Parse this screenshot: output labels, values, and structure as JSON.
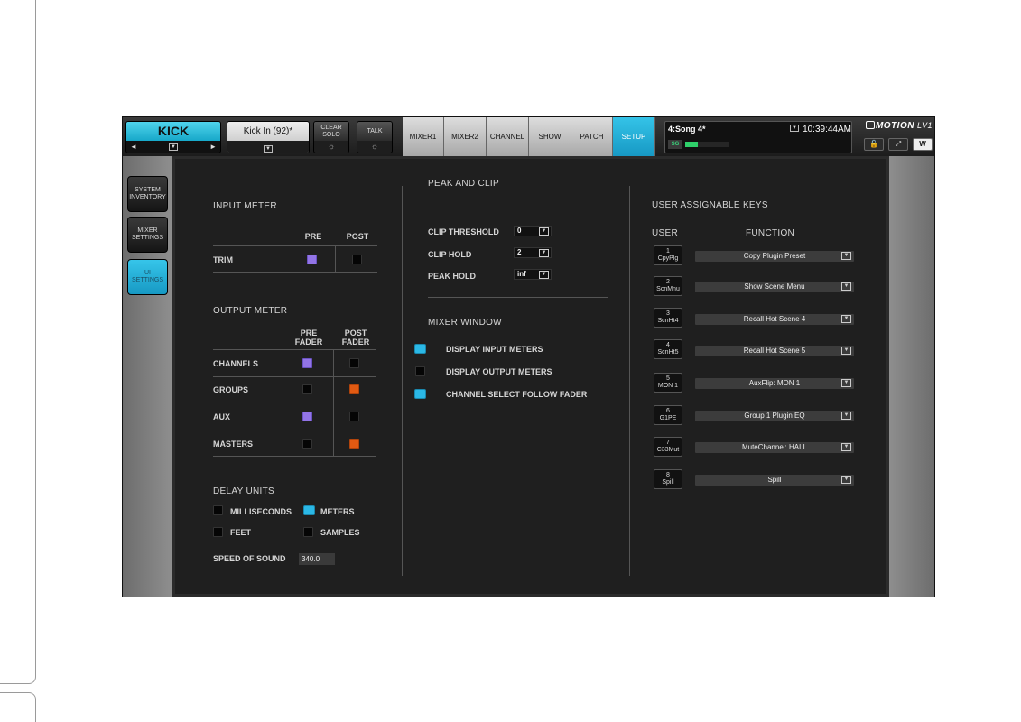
{
  "header": {
    "channel_name": "KICK",
    "channel_prev": "◄",
    "channel_next": "►",
    "channel_dd": "▼",
    "scene_name": "Kick In (92)*",
    "scene_dd": "▼",
    "clear_solo": "CLEAR\nSOLO",
    "talk": "TALK",
    "gear": "☼",
    "tabs": [
      "MIXER1",
      "MIXER2",
      "CHANNEL",
      "SHOW",
      "PATCH",
      "SETUP"
    ],
    "active_tab": "SETUP",
    "song": "4:Song 4*",
    "song_dd": "▼",
    "clock": "10:39:44AM",
    "sg_label": "SG",
    "sg_level": 0.3,
    "brand": "MOTION",
    "brand_suffix": "LV1",
    "lock_icon": "🔓",
    "expand_icon": "⤢",
    "waves_icon": "W"
  },
  "sidebar": {
    "items": [
      "SYSTEM\nINVENTORY",
      "MIXER\nSETTINGS",
      "UI\nSETTINGS"
    ],
    "active": "UI\nSETTINGS"
  },
  "input_meter": {
    "title": "INPUT METER",
    "col_pre": "PRE",
    "col_post": "POST",
    "row_trim": "TRIM"
  },
  "output_meter": {
    "title": "OUTPUT METER",
    "col_pre": "PRE\nFADER",
    "col_post": "POST\nFADER",
    "rows": [
      {
        "label": "CHANNELS",
        "pre": "purple",
        "post": "off"
      },
      {
        "label": "GROUPS",
        "pre": "off",
        "post": "orange"
      },
      {
        "label": "AUX",
        "pre": "purple",
        "post": "off"
      },
      {
        "label": "MASTERS",
        "pre": "off",
        "post": "orange"
      }
    ]
  },
  "delay_units": {
    "title": "DELAY UNITS",
    "milliseconds": "MILLISECONDS",
    "meters": "METERS",
    "feet": "FEET",
    "samples": "SAMPLES",
    "speed_label": "SPEED OF SOUND",
    "speed_value": "340.0"
  },
  "peak_clip": {
    "title": "PEAK AND CLIP",
    "clip_threshold_label": "CLIP THRESHOLD",
    "clip_threshold_value": "0",
    "clip_hold_label": "CLIP HOLD",
    "clip_hold_value": "2",
    "peak_hold_label": "PEAK HOLD",
    "peak_hold_value": "inf",
    "dd": "▼"
  },
  "mixer_window": {
    "title": "MIXER WINDOW",
    "display_input": "DISPLAY INPUT METERS",
    "display_output": "DISPLAY OUTPUT METERS",
    "channel_select": "CHANNEL SELECT FOLLOW FADER"
  },
  "user_keys": {
    "title": "USER ASSIGNABLE KEYS",
    "col_user": "USER",
    "col_function": "FUNCTION",
    "keys": [
      {
        "num": "1",
        "short": "CpyPlg",
        "function": "Copy Plugin Preset"
      },
      {
        "num": "2",
        "short": "ScnMnu",
        "function": "Show Scene Menu"
      },
      {
        "num": "3",
        "short": "ScnHt4",
        "function": "Recall Hot Scene 4"
      },
      {
        "num": "4",
        "short": "ScnHt5",
        "function": "Recall Hot Scene 5"
      },
      {
        "num": "5",
        "short": "MON 1",
        "function": "AuxFlip: MON 1"
      },
      {
        "num": "6",
        "short": "G1PE",
        "function": "Group 1 Plugin EQ"
      },
      {
        "num": "7",
        "short": "C33Mut",
        "function": "MuteChannel: HALL"
      },
      {
        "num": "8",
        "short": "Spill",
        "function": "Spill"
      }
    ],
    "dd": "▼"
  }
}
